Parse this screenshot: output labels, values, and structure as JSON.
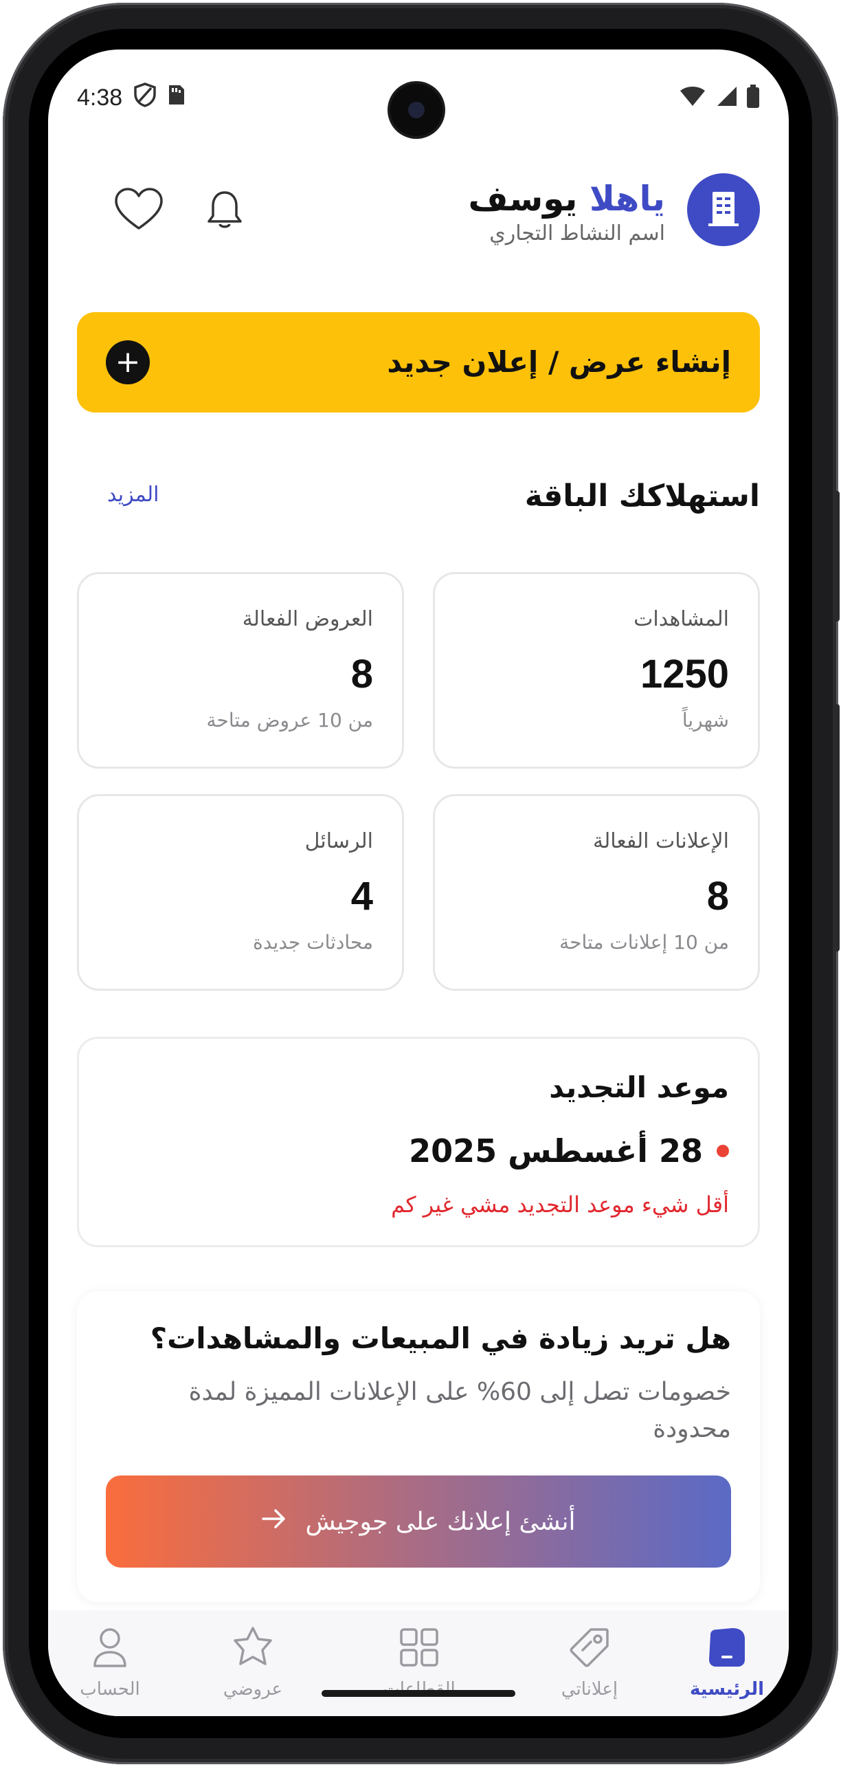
{
  "status_bar": {
    "time": "4:38"
  },
  "header": {
    "greeting_prefix": "ياهلا",
    "user_name": "يوسف",
    "business_name": "اسم النشاط التجاري"
  },
  "cta": {
    "label": "إنشاء عرض / إعلان جديد"
  },
  "usage": {
    "title": "استهلاكك الباقة",
    "more_label": "المزيد",
    "cards": [
      {
        "label": "المشاهدات",
        "value": "1250",
        "sub": "شهرياً"
      },
      {
        "label": "العروض الفعالة",
        "value": "8",
        "sub": "من 10 عروض متاحة"
      },
      {
        "label": "الإعلانات الفعالة",
        "value": "8",
        "sub": "من 10 إعلانات متاحة"
      },
      {
        "label": "الرسائل",
        "value": "4",
        "sub": "محادثات جديدة"
      }
    ]
  },
  "renewal": {
    "title": "موعد التجديد",
    "date": "28 أغسطس 2025",
    "warning": "أقل شيء موعد التجديد مشي غير كم"
  },
  "promo": {
    "title": "هل تريد زيادة في المبيعات والمشاهدات؟",
    "body": "خصومات تصل إلى 60% على الإعلانات المميزة لمدة محدودة",
    "button_label": "أنشئ إعلانك على جوجيش"
  },
  "nav": {
    "items": [
      {
        "label": "الرئيسية",
        "icon": "home-icon",
        "active": true
      },
      {
        "label": "إعلاناتي",
        "icon": "tag-icon",
        "active": false
      },
      {
        "label": "القطاعات",
        "icon": "grid-icon",
        "active": false
      },
      {
        "label": "عروضي",
        "icon": "badge-star-icon",
        "active": false
      },
      {
        "label": "الحساب",
        "icon": "user-icon",
        "active": false
      }
    ]
  },
  "colors": {
    "accent": "#3f4bc4",
    "cta_yellow": "#fdc10a",
    "warning_red": "#e0282e",
    "gradient_start": "#fa6d3d",
    "gradient_end": "#5b6ac6"
  }
}
